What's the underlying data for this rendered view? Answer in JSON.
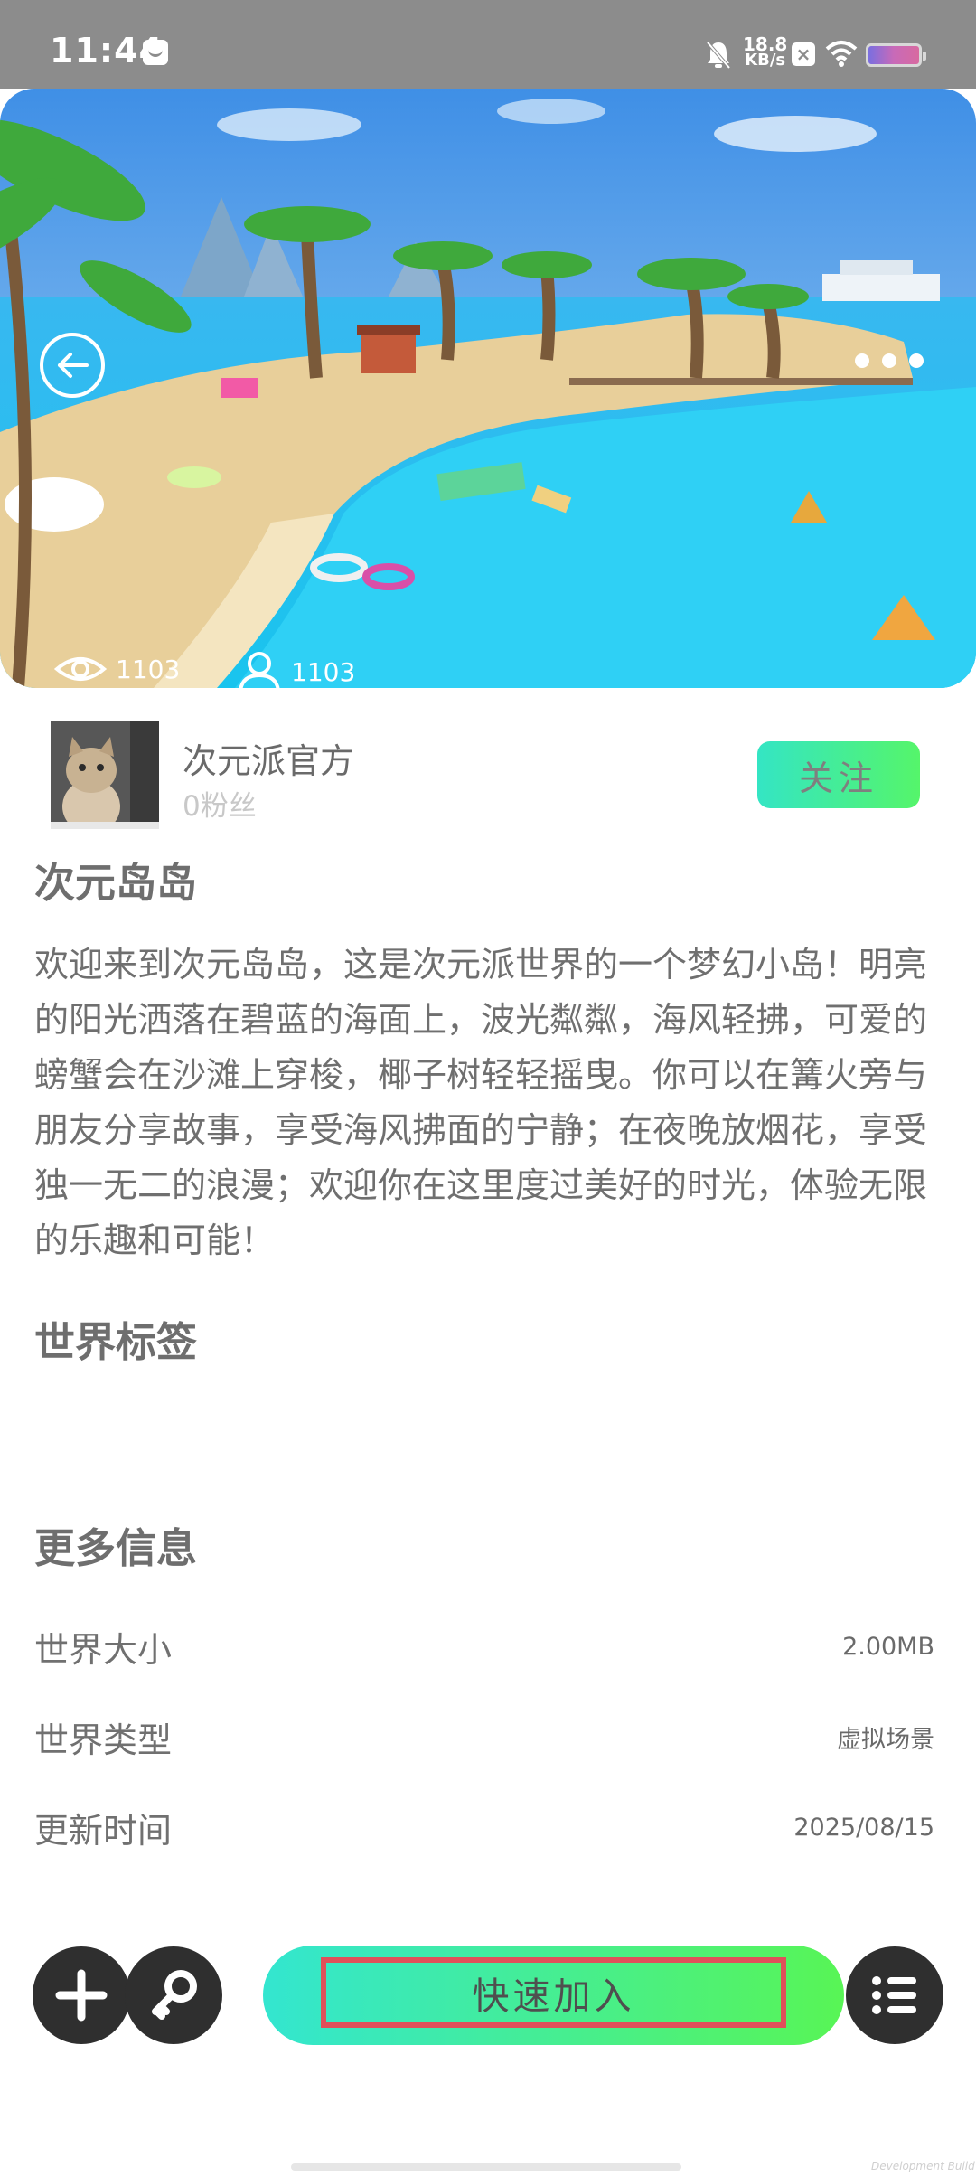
{
  "status_bar": {
    "time": "11:44",
    "speed_value": "18.8",
    "speed_unit": "KB/s",
    "icons": [
      "message-icon",
      "bell-muted-icon",
      "close-box-icon",
      "wifi-icon",
      "battery-icon"
    ]
  },
  "hero": {
    "views": "1103",
    "players": "1103",
    "icons": [
      "back-arrow-icon",
      "more-dots-icon",
      "eye-icon",
      "person-icon"
    ]
  },
  "author": {
    "name": "次元派官方",
    "fans": "0粉丝",
    "follow_label": "关注"
  },
  "world": {
    "title": "次元岛岛",
    "description": "欢迎来到次元岛岛，这是次元派世界的一个梦幻小岛！明亮的阳光洒落在碧蓝的海面上，波光粼粼，海风轻拂，可爱的螃蟹会在沙滩上穿梭，椰子树轻轻摇曳。你可以在篝火旁与朋友分享故事，享受海风拂面的宁静；在夜晚放烟花，享受独一无二的浪漫；欢迎你在这里度过美好的时光，体验无限的乐趣和可能！"
  },
  "tags_section": {
    "title": "世界标签",
    "tags": []
  },
  "more_info": {
    "title": "更多信息",
    "rows": [
      {
        "key": "世界大小",
        "value": "2.00MB"
      },
      {
        "key": "世界类型",
        "value": "虚拟场景"
      },
      {
        "key": "更新时间",
        "value": "2025/08/15"
      }
    ]
  },
  "bottom_bar": {
    "join_label": "快速加入",
    "icons": [
      "plus-icon",
      "key-icon",
      "menu-list-icon"
    ]
  },
  "watermark": "Development Build",
  "colors": {
    "accent_start": "#34e5c4",
    "accent_end": "#55f56a",
    "highlight_border": "#e0505a",
    "dark_button": "#2f2f2f"
  }
}
